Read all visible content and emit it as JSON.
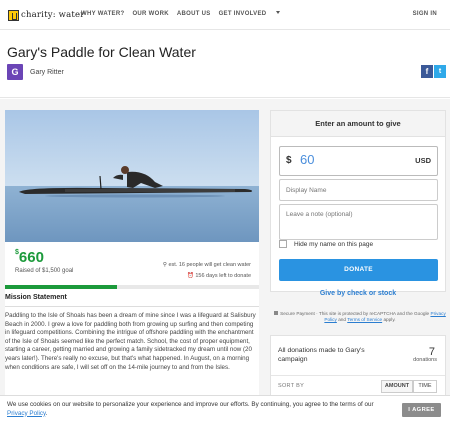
{
  "nav": {
    "logo_text": "charity: water",
    "links": [
      "WHY WATER?",
      "OUR WORK",
      "ABOUT US",
      "GET INVOLVED"
    ],
    "signin": "SIGN IN"
  },
  "header": {
    "title": "Gary's Paddle for Clean Water",
    "avatar_letter": "G",
    "author": "Gary Ritter",
    "share": {
      "facebook": "f",
      "twitter": "t"
    },
    "colors": {
      "avatar": "#6b45b6",
      "facebook": "#3b5998",
      "twitter": "#2fa9e9"
    }
  },
  "campaign": {
    "currency_symbol": "$",
    "raised": "660",
    "goal_text": "Raised of $1,500 goal",
    "people_text": "est. 16 people will get clean water",
    "days_text": "156 days left to donate",
    "progress_percent": 44,
    "colors": {
      "raised": "#1c9a3b"
    }
  },
  "mission": {
    "title": "Mission Statement",
    "text": "Paddling to the Isle of Shoals has been a dream of mine since I was a lifeguard at Salisbury Beach in 2000. I grew a love for paddling both from growing up surfing and then competing in lifeguard competitions. Combining the intrigue of offshore paddling with the enchantment of the Isle of Shoals seemed like the perfect match. School, the cost of proper equipment, starting a career, getting married and growing a family sidetracked my dream until now (20 years later!). There's really no excuse, but that's what happened. In August, on a morning when conditions are safe, I will set off on the 14-mile journey to and from the Isles."
  },
  "donate": {
    "heading": "Enter an amount to give",
    "currency_symbol": "$",
    "amount": "60",
    "currency": "USD",
    "name_placeholder": "Display Name",
    "note_placeholder": "Leave a note (optional)",
    "hide_label": "Hide my name on this page",
    "button": "DONATE",
    "alt_link": "Give by check or stock",
    "secure_prefix": "Secure Payment · This site is protected by reCAPTCHA and the Google",
    "privacy_link": "Privacy Policy",
    "and_text": "and",
    "terms_link": "Terms of Service",
    "apply_text": "apply.",
    "colors": {
      "button": "#2a93e1"
    }
  },
  "donations": {
    "title": "All donations made to Gary's campaign",
    "count": "7",
    "count_label": "donations",
    "sort_label": "SORT BY",
    "sort_amount": "AMOUNT",
    "sort_time": "TIME"
  },
  "cookie": {
    "text": "We use cookies on our website to personalize your experience and improve our efforts. By continuing, you agree to the terms of our",
    "link": "Privacy Policy",
    "end": ".",
    "button": "I AGREE"
  }
}
